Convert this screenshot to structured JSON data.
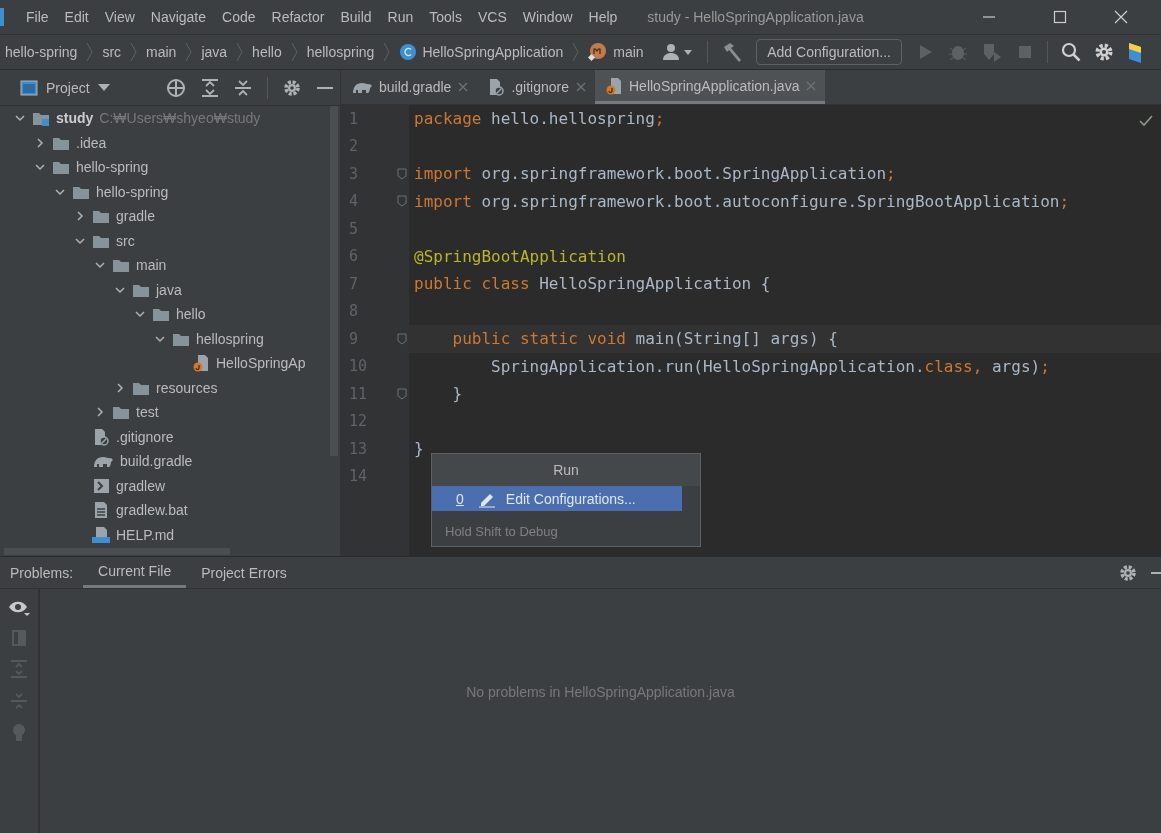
{
  "menu": [
    {
      "label": "File"
    },
    {
      "label": "Edit"
    },
    {
      "label": "View"
    },
    {
      "label": "Navigate"
    },
    {
      "label": "Code"
    },
    {
      "label": "Refactor"
    },
    {
      "label": "Build"
    },
    {
      "label": "Run"
    },
    {
      "label": "Tools"
    },
    {
      "label": "VCS"
    },
    {
      "label": "Window"
    },
    {
      "label": "Help"
    }
  ],
  "window": {
    "title": "study - HelloSpringApplication.java"
  },
  "breadcrumbs": [
    {
      "label": "hello-spring",
      "kind": "plain"
    },
    {
      "label": "src",
      "kind": "plain"
    },
    {
      "label": "main",
      "kind": "plain"
    },
    {
      "label": "java",
      "kind": "plain"
    },
    {
      "label": "hello",
      "kind": "plain"
    },
    {
      "label": "hellospring",
      "kind": "plain"
    },
    {
      "label": "HelloSpringApplication",
      "kind": "class"
    },
    {
      "label": "main",
      "kind": "method"
    }
  ],
  "toolbar": {
    "configuration": "Add Configuration..."
  },
  "project_panel": {
    "title": "Project",
    "tree": [
      {
        "label": "study",
        "kind": "module",
        "path": "C:₩Users₩shyeo₩study",
        "expanded": true,
        "children": [
          {
            "label": ".idea",
            "kind": "folder",
            "expanded": false
          },
          {
            "label": "hello-spring",
            "kind": "folder",
            "expanded": true,
            "children": [
              {
                "label": "hello-spring",
                "kind": "folder",
                "expanded": true,
                "children": [
                  {
                    "label": "gradle",
                    "kind": "folder",
                    "expanded": false
                  },
                  {
                    "label": "src",
                    "kind": "folder",
                    "expanded": true,
                    "children": [
                      {
                        "label": "main",
                        "kind": "folder",
                        "expanded": true,
                        "children": [
                          {
                            "label": "java",
                            "kind": "folder",
                            "expanded": true,
                            "children": [
                              {
                                "label": "hello",
                                "kind": "folder",
                                "expanded": true,
                                "children": [
                                  {
                                    "label": "hellospring",
                                    "kind": "folder",
                                    "expanded": true,
                                    "children": [
                                      {
                                        "label": "HelloSpringAp",
                                        "kind": "java"
                                      }
                                    ]
                                  }
                                ]
                              }
                            ]
                          },
                          {
                            "label": "resources",
                            "kind": "folder",
                            "expanded": false
                          }
                        ]
                      },
                      {
                        "label": "test",
                        "kind": "folder",
                        "expanded": false
                      }
                    ]
                  },
                  {
                    "label": ".gitignore",
                    "kind": "gitignore"
                  },
                  {
                    "label": "build.gradle",
                    "kind": "gradle"
                  },
                  {
                    "label": "gradlew",
                    "kind": "script"
                  },
                  {
                    "label": "gradlew.bat",
                    "kind": "text"
                  },
                  {
                    "label": "HELP.md",
                    "kind": "markdown"
                  }
                ]
              }
            ]
          }
        ]
      }
    ]
  },
  "editor_tabs": [
    {
      "label": "build.gradle",
      "kind": "gradle",
      "selected": false
    },
    {
      "label": ".gitignore",
      "kind": "gitignore",
      "selected": false
    },
    {
      "label": "HelloSpringApplication.java",
      "kind": "java",
      "selected": true
    }
  ],
  "code_lines": [
    {
      "number": "1",
      "fold": false,
      "current": false,
      "segments": [
        {
          "text": "package ",
          "kind": "keyword"
        },
        {
          "text": "hello.hellospring",
          "kind": "plain"
        },
        {
          "text": ";",
          "kind": "keyword"
        }
      ]
    },
    {
      "number": "2",
      "fold": false,
      "current": false
    },
    {
      "number": "3",
      "fold": true,
      "current": false,
      "segments": [
        {
          "text": "import ",
          "kind": "keyword"
        },
        {
          "text": "org.springframework.boot.SpringApplication",
          "kind": "plain"
        },
        {
          "text": ";",
          "kind": "keyword"
        }
      ]
    },
    {
      "number": "4",
      "fold": true,
      "current": false,
      "segments": [
        {
          "text": "import ",
          "kind": "keyword"
        },
        {
          "text": "org.springframework.boot.autoconfigure.SpringBootApplication",
          "kind": "plain"
        },
        {
          "text": ";",
          "kind": "keyword"
        }
      ]
    },
    {
      "number": "5",
      "fold": false,
      "current": false
    },
    {
      "number": "6",
      "fold": false,
      "current": false,
      "segments": [
        {
          "text": "@SpringBootApplication",
          "kind": "annotation"
        }
      ]
    },
    {
      "number": "7",
      "fold": false,
      "current": false,
      "segments": [
        {
          "text": "public class ",
          "kind": "keyword"
        },
        {
          "text": "HelloSpringApplication {",
          "kind": "plain"
        }
      ]
    },
    {
      "number": "8",
      "fold": false,
      "current": false
    },
    {
      "number": "9",
      "fold": true,
      "current": true,
      "segments": [
        {
          "text": "    public static void ",
          "kind": "keyword"
        },
        {
          "text": "main(String[] args) {",
          "kind": "plain"
        }
      ]
    },
    {
      "number": "10",
      "fold": false,
      "current": false,
      "segments": [
        {
          "text": "        SpringApplication.run(HelloSpringApplication.",
          "kind": "plain"
        },
        {
          "text": "class, ",
          "kind": "keyword"
        },
        {
          "text": "args)",
          "kind": "plain"
        },
        {
          "text": ";",
          "kind": "keyword"
        }
      ]
    },
    {
      "number": "11",
      "fold": true,
      "current": false,
      "segments": [
        {
          "text": "    }",
          "kind": "plain"
        }
      ]
    },
    {
      "number": "12",
      "fold": false,
      "current": false
    },
    {
      "number": "13",
      "fold": false,
      "current": false,
      "segments": [
        {
          "text": "}",
          "kind": "plain"
        }
      ]
    },
    {
      "number": "14",
      "fold": false,
      "current": false
    }
  ],
  "run_popup": {
    "title": "Run",
    "items": [
      {
        "mnemonic": "0",
        "label": "Edit Configurations...",
        "selected": true
      }
    ],
    "footer": "Hold Shift to Debug"
  },
  "problems_panel": {
    "label": "Problems:",
    "tabs": [
      {
        "label": "Current File",
        "selected": true
      },
      {
        "label": "Project Errors",
        "selected": false
      }
    ],
    "message": "No problems in HelloSpringApplication.java"
  }
}
